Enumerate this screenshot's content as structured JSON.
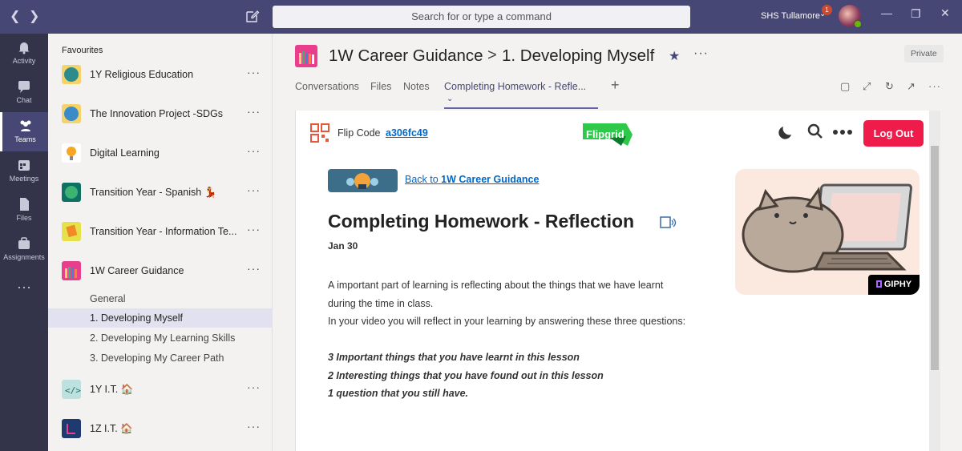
{
  "titlebar": {
    "search_placeholder": "Search for or type a command",
    "tenant": "SHS Tullamore",
    "notification_count": "1"
  },
  "rail": [
    {
      "label": "Activity",
      "icon": "bell-icon"
    },
    {
      "label": "Chat",
      "icon": "chat-icon"
    },
    {
      "label": "Teams",
      "icon": "teams-icon",
      "active": true
    },
    {
      "label": "Meetings",
      "icon": "calendar-icon"
    },
    {
      "label": "Files",
      "icon": "file-icon"
    },
    {
      "label": "Assignments",
      "icon": "assignments-icon"
    }
  ],
  "sidebar": {
    "favourites_label": "Favourites",
    "teams": [
      {
        "name": "1Y Religious Education",
        "color": "#f4d36b"
      },
      {
        "name": "The Innovation Project -SDGs",
        "color": "#f4d36b"
      },
      {
        "name": "Digital Learning",
        "color": "#ffffff"
      },
      {
        "name": "Transition Year - Spanish 💃",
        "color": "#0f7064"
      },
      {
        "name": "Transition Year - Information Te...",
        "color": "#e6e14b"
      },
      {
        "name": "1W Career Guidance",
        "color": "#e83e8c"
      },
      {
        "name": "1Y I.T. 🏠",
        "color": "#bde0e0"
      },
      {
        "name": "1Z I.T. 🏠",
        "color": "#1f3a6e"
      }
    ],
    "channels": [
      "General",
      "1. Developing Myself",
      "2. Developing My Learning Skills",
      "3. Developing My Career Path"
    ]
  },
  "header": {
    "team": "1W Career Guidance",
    "separator": ">",
    "channel": "1. Developing Myself",
    "privacy": "Private"
  },
  "tabs": [
    "Conversations",
    "Files",
    "Notes",
    "Completing Homework - Refle..."
  ],
  "flipgrid": {
    "code_label": "Flip Code",
    "code": "a306fc49",
    "logo_text": "Flipgrid",
    "logout": "Log Out",
    "back_prefix": "Back to",
    "back_team": "1W Career Guidance",
    "topic_title": "Completing Homework - Reflection",
    "date": "Jan 30",
    "lines": [
      "A important part of learning is reflecting about the things that we have learnt",
      "during the time in class.",
      "In your video you will reflect in your learning by answering these three questions:"
    ],
    "questions": [
      "3 Important things that you have learnt in this lesson",
      "2 Interesting things that you have found out in this lesson",
      "1 question that you still have."
    ],
    "giphy": "GIPHY"
  }
}
